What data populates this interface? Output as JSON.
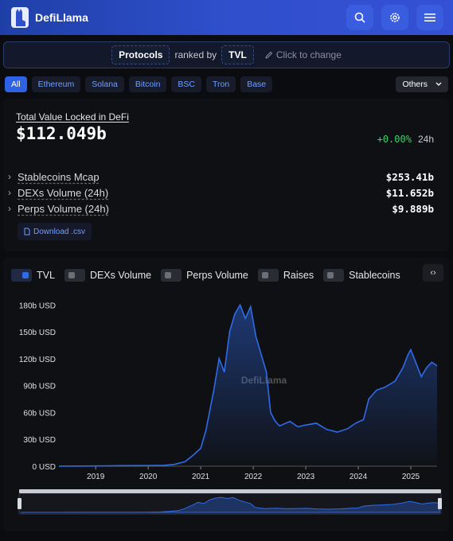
{
  "header": {
    "brand": "DefiLlama",
    "icons": [
      "search-icon",
      "gear-icon",
      "menu-icon"
    ]
  },
  "ranking": {
    "entity": "Protocols",
    "ranked_by_text": "ranked by",
    "metric": "TVL",
    "hint": "Click to change"
  },
  "chains": [
    "All",
    "Ethereum",
    "Solana",
    "Bitcoin",
    "BSC",
    "Tron",
    "Base"
  ],
  "chains_selected": "All",
  "others_label": "Others",
  "stats": {
    "tvl_label": "Total Value Locked in DeFi",
    "tvl_value": "$112.049b",
    "change_pct": "+0.00%",
    "change_period": "24h",
    "metrics": [
      {
        "name": "Stablecoins Mcap",
        "value": "$253.41b"
      },
      {
        "name": "DEXs Volume (24h)",
        "value": "$11.652b"
      },
      {
        "name": "Perps Volume (24h)",
        "value": "$9.889b"
      }
    ],
    "download_label": "Download .csv"
  },
  "toggles": [
    {
      "label": "TVL",
      "on": true
    },
    {
      "label": "DEXs Volume",
      "on": false
    },
    {
      "label": "Perps Volume",
      "on": false
    },
    {
      "label": "Raises",
      "on": false
    },
    {
      "label": "Stablecoins",
      "on": false
    }
  ],
  "chart_data": {
    "type": "area",
    "series": [
      {
        "name": "TVL"
      }
    ],
    "x": [
      2018.3,
      2019.0,
      2019.5,
      2020.0,
      2020.3,
      2020.5,
      2020.7,
      2020.85,
      2021.0,
      2021.1,
      2021.25,
      2021.35,
      2021.45,
      2021.55,
      2021.65,
      2021.75,
      2021.85,
      2021.95,
      2022.05,
      2022.15,
      2022.25,
      2022.33,
      2022.4,
      2022.45,
      2022.5,
      2022.7,
      2022.85,
      2023.0,
      2023.2,
      2023.4,
      2023.6,
      2023.8,
      2023.95,
      2024.1,
      2024.2,
      2024.35,
      2024.5,
      2024.7,
      2024.85,
      2024.95,
      2025.0,
      2025.1,
      2025.2,
      2025.3,
      2025.4,
      2025.5
    ],
    "y": [
      0.1,
      0.3,
      0.6,
      0.7,
      1,
      2,
      5,
      12,
      20,
      40,
      85,
      120,
      105,
      150,
      170,
      180,
      165,
      178,
      145,
      125,
      105,
      60,
      52,
      48,
      45,
      50,
      44,
      46,
      48,
      41,
      38,
      42,
      48,
      52,
      75,
      85,
      88,
      95,
      110,
      125,
      130,
      115,
      100,
      110,
      116,
      112
    ],
    "xlim": [
      2018.3,
      2025.5
    ],
    "ylim": [
      0,
      190
    ],
    "y_ticks": [
      "0 USD",
      "30b USD",
      "60b USD",
      "90b USD",
      "120b USD",
      "150b USD",
      "180b USD"
    ],
    "x_ticks": [
      "2019",
      "2020",
      "2021",
      "2022",
      "2023",
      "2024",
      "2025"
    ],
    "watermark": "DefiLlama",
    "color": "#2f6be8"
  },
  "colors": {
    "accent": "#2f6be8",
    "positive": "#3ecf6e"
  }
}
